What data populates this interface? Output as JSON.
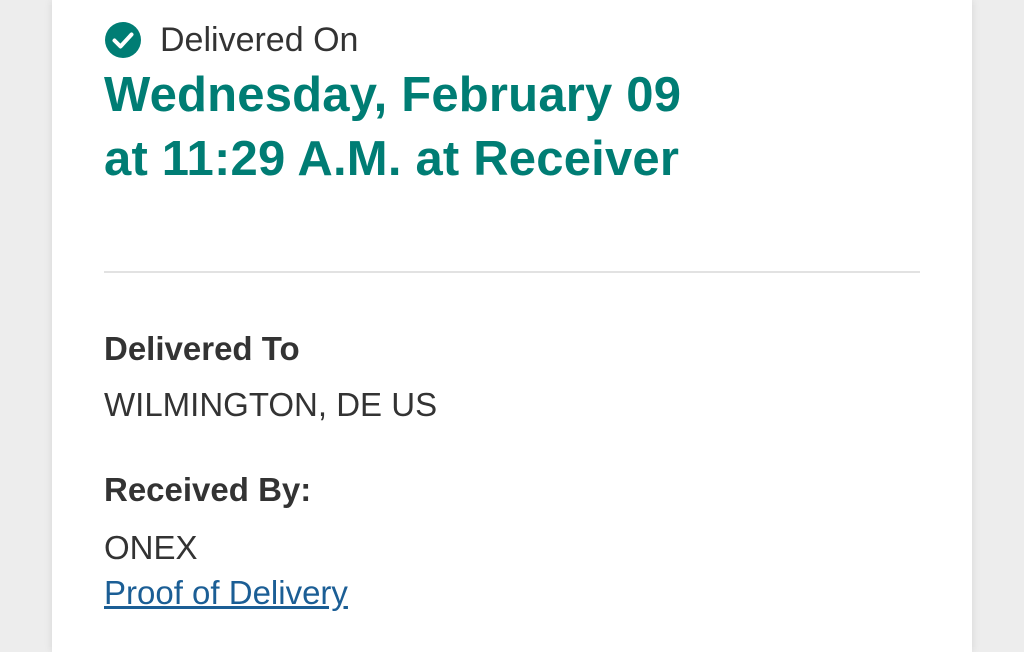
{
  "colors": {
    "accent": "#007d74",
    "text": "#333333",
    "link": "#1b5e95",
    "divider": "#e2e2e2",
    "background": "#ededed",
    "card": "#ffffff"
  },
  "status": {
    "icon": "check-circle-icon",
    "label": "Delivered On"
  },
  "delivery": {
    "date_line": "Wednesday, February 09",
    "time_line": "at 11:29 A.M. at Receiver"
  },
  "delivered_to": {
    "label": "Delivered To",
    "value": "WILMINGTON, DE US"
  },
  "received_by": {
    "label": "Received By:",
    "value": "ONEX"
  },
  "proof_link": {
    "label": "Proof of Delivery"
  }
}
